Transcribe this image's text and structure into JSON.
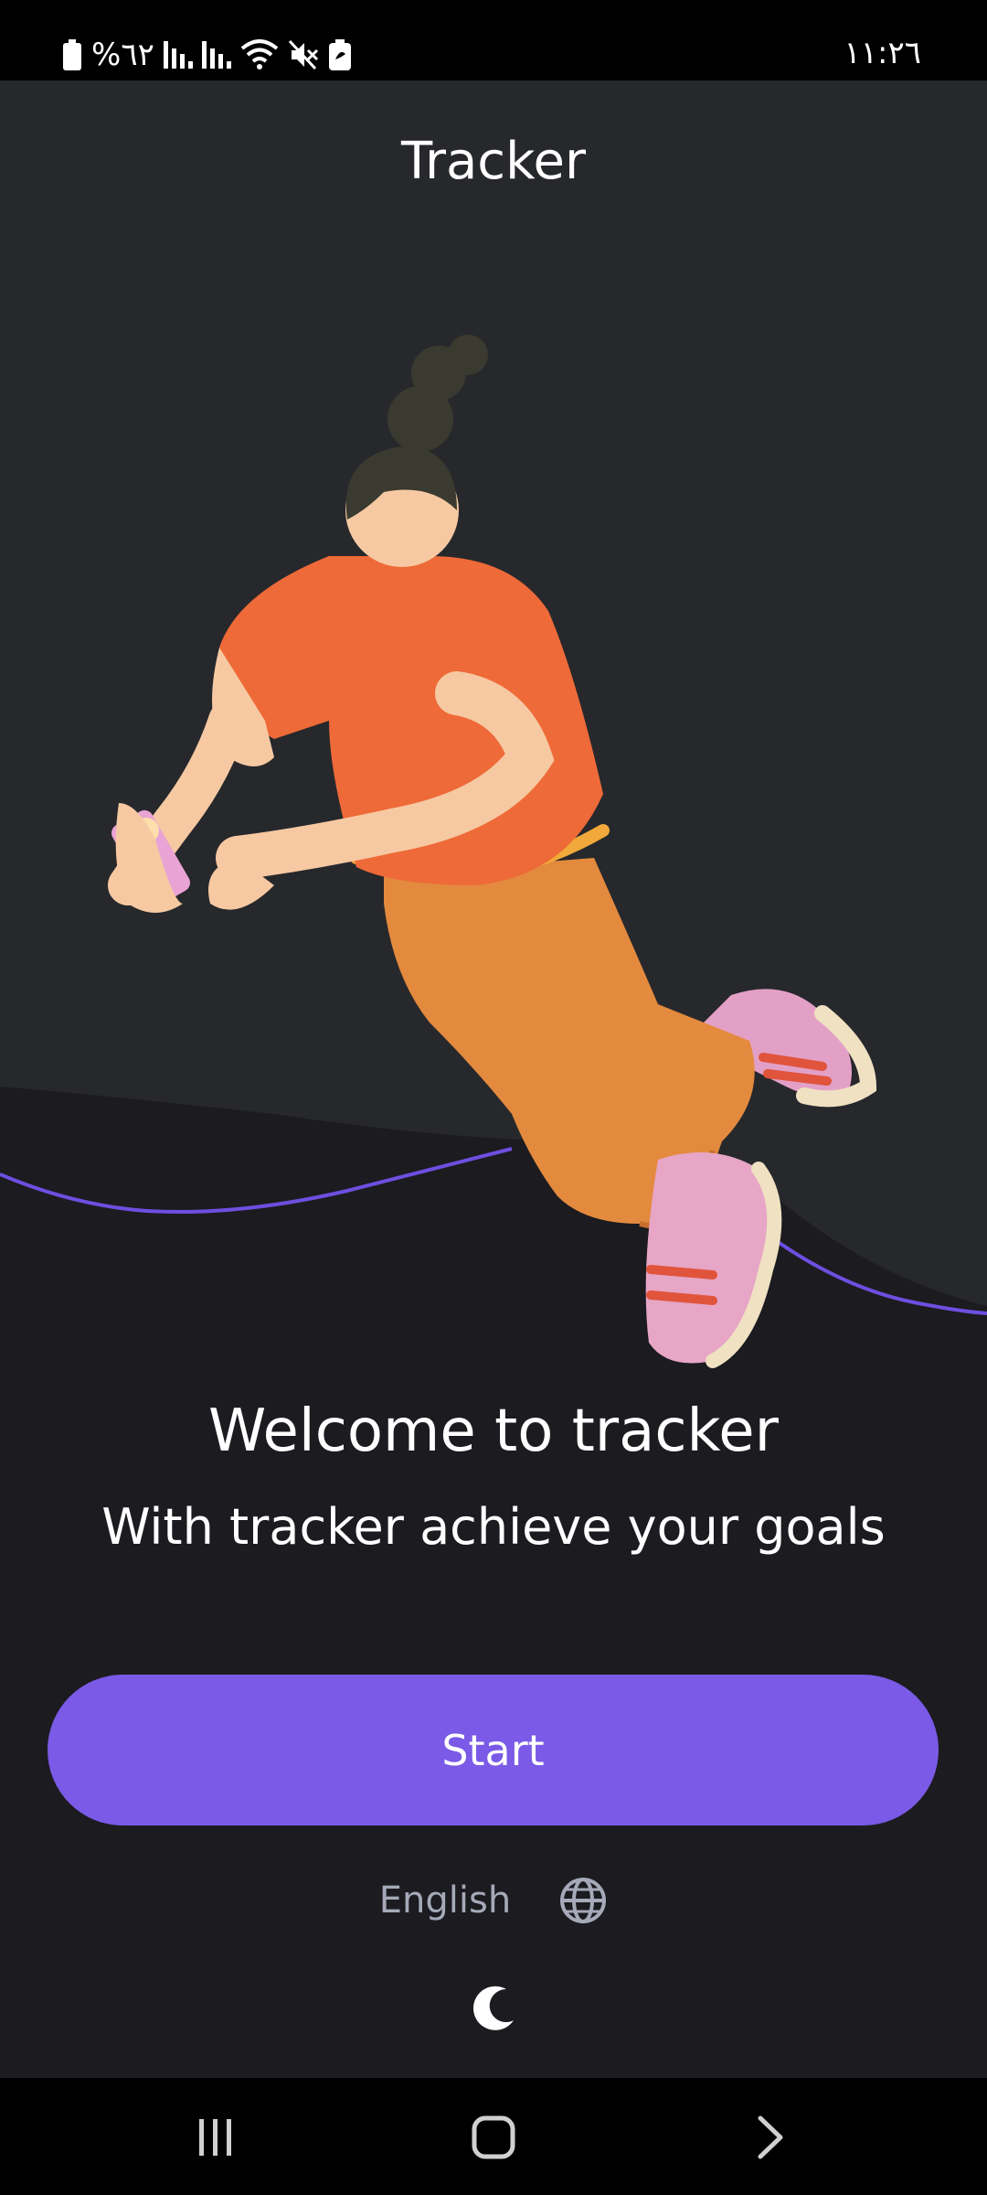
{
  "status_bar": {
    "battery_percent": "%٦٢",
    "time": "١١:٢٦",
    "icons": [
      "battery-icon",
      "signal-icon",
      "signal-icon",
      "wifi-icon",
      "mute-icon",
      "battery-saver-icon"
    ]
  },
  "header": {
    "title": "Tracker"
  },
  "welcome": {
    "title": "Welcome to tracker",
    "subtitle": "With tracker achieve your goals"
  },
  "actions": {
    "start_label": "Start"
  },
  "settings": {
    "language_label": "English",
    "language_icon": "globe-icon",
    "theme_icon": "moon-icon"
  },
  "nav": {
    "icons": [
      "recent-apps-icon",
      "home-icon",
      "back-icon"
    ]
  },
  "colors": {
    "background": "#1b1b20",
    "header_background": "#27282c",
    "accent": "#7a5ae6",
    "wave_line": "#6d4fe0",
    "secondary_text": "#a5a9b8"
  }
}
